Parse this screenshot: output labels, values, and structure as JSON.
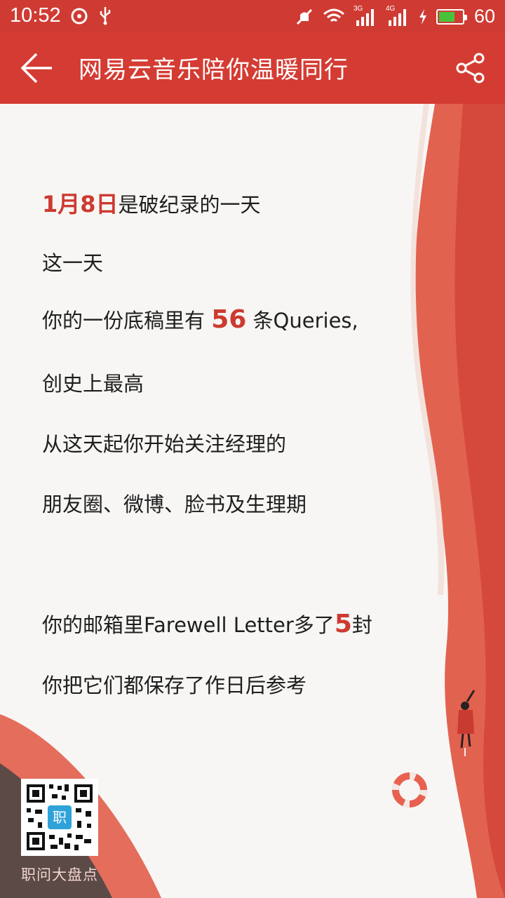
{
  "status_bar": {
    "time": "10:52",
    "network_3g": "3G",
    "network_4g": "4G",
    "battery": "60"
  },
  "app_bar": {
    "title": "网易云音乐陪你温暖同行"
  },
  "letter": {
    "line1": {
      "highlight": "1月8日",
      "rest": "是破纪录的一天"
    },
    "line2": "这一天",
    "line3": {
      "before": "你的一份底稿里有 ",
      "number": "56",
      "after": " 条Queries,"
    },
    "line4": "创史上最高",
    "line5": "从这天起你开始关注经理的",
    "line6": "朋友圈、微博、脸书及生理期",
    "line7": {
      "before": "你的邮箱里Farewell Letter多了",
      "number": "5",
      "after": "封"
    },
    "line8": "你把它们都保存了作日后参考"
  },
  "watermark": {
    "qr_center_char": "职",
    "label": "职问大盘点"
  },
  "colors": {
    "accent": "#d43c33",
    "highlight": "#cd3a2f",
    "background": "#f7f6f4"
  }
}
